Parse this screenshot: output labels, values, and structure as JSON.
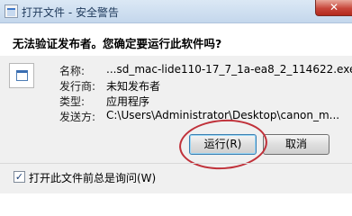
{
  "window": {
    "title": "打开文件 - 安全警告",
    "close_glyph": "✕"
  },
  "dialog": {
    "question": "无法验证发布者。您确定要运行此软件吗?",
    "file_icon": "file-icon",
    "fields": [
      {
        "label": "名称:",
        "value": "...sd_mac-lide110-17_7_1a-ea8_2_114622.exe"
      },
      {
        "label": "发行商:",
        "value": "未知发布者"
      },
      {
        "label": "类型:",
        "value": "应用程序"
      },
      {
        "label": "发送方:",
        "value": "C:\\Users\\Administrator\\Desktop\\canon_m..."
      }
    ],
    "buttons": {
      "run": "运行(R)",
      "cancel": "取消"
    },
    "checkbox": {
      "label": "打开此文件前总是询问(W)",
      "checked": true,
      "check_glyph": "✓"
    }
  },
  "annotation_color": "#c0313a"
}
